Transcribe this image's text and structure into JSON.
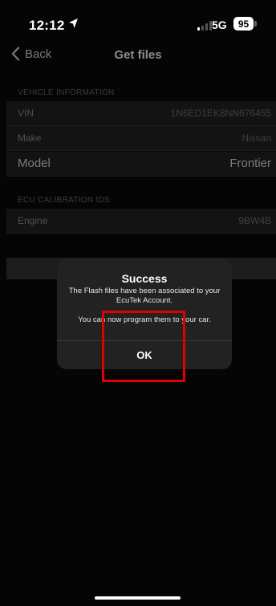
{
  "status_bar": {
    "time": "12:12",
    "network": "5G",
    "battery": "95"
  },
  "nav": {
    "back_label": "Back",
    "title": "Get files"
  },
  "vehicle_section": {
    "header": "VEHICLE INFORMATION",
    "rows": [
      {
        "label": "VIN",
        "value": "1N6ED1EK8NN676455"
      },
      {
        "label": "Make",
        "value": "Nissan"
      },
      {
        "label": "Model",
        "value": "Frontier"
      }
    ]
  },
  "ecu_section": {
    "header": "ECU CALIBRATION IDS",
    "rows": [
      {
        "label": "Engine",
        "value": "9BW4B"
      }
    ]
  },
  "alert": {
    "title": "Success",
    "message_line1": "The Flash files have been associated to your EcuTek Account.",
    "message_line2": "You can now program them to your car.",
    "ok_label": "OK"
  },
  "colors": {
    "highlight": "#e00000",
    "alert_bg": "#222223"
  }
}
